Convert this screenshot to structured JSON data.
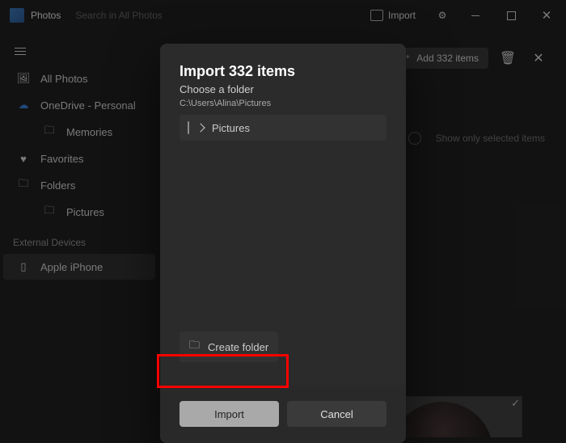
{
  "app": {
    "name": "Photos",
    "search_placeholder": "Search in All Photos"
  },
  "titlebar": {
    "import_label": "Import"
  },
  "sidebar": {
    "all_photos": "All Photos",
    "onedrive": "OneDrive - Personal",
    "memories": "Memories",
    "favorites": "Favorites",
    "folders": "Folders",
    "pictures": "Pictures",
    "section_external": "External Devices",
    "device": "Apple iPhone"
  },
  "toolbar": {
    "add_items": "Add 332 items",
    "show_selected": "Show only selected items"
  },
  "dialog": {
    "title": "Import 332 items",
    "subtitle": "Choose a folder",
    "path": "C:\\Users\\Alina\\Pictures",
    "folder": "Pictures",
    "create_folder": "Create folder",
    "import": "Import",
    "cancel": "Cancel"
  }
}
